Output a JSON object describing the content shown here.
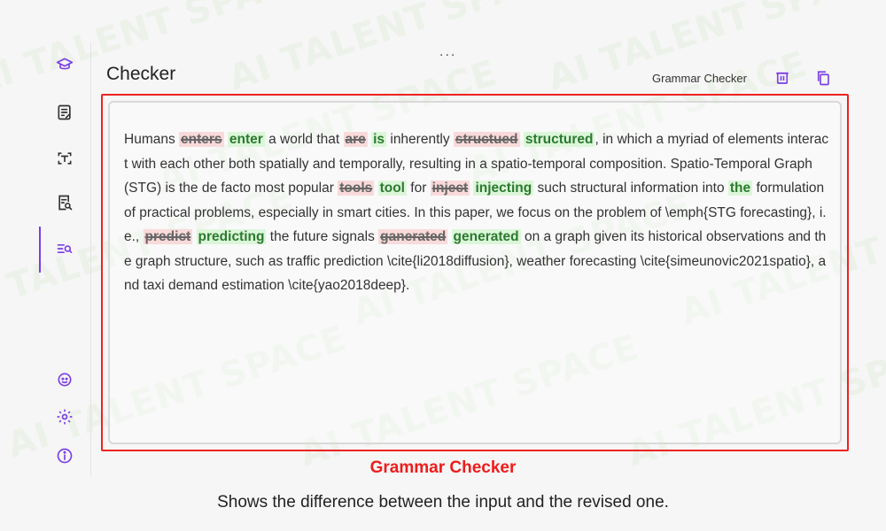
{
  "header": {
    "more_label": "...",
    "title": "Checker",
    "mode_label": "Grammar Checker"
  },
  "sidebar": {
    "items": [
      {
        "icon": "graduation-cap-icon"
      },
      {
        "icon": "edit-note-icon"
      },
      {
        "icon": "text-scan-icon"
      },
      {
        "icon": "document-search-icon"
      },
      {
        "icon": "list-search-icon",
        "active": true
      }
    ],
    "bottom": [
      {
        "icon": "assistant-face-icon"
      },
      {
        "icon": "settings-gear-icon"
      },
      {
        "icon": "info-icon"
      }
    ]
  },
  "colors": {
    "accent": "#7b3fe4",
    "highlight_frame": "#ee2222",
    "deleted_bg": "#f9dada",
    "inserted_bg": "#dcf6d9",
    "inserted_text": "#2b7a2f"
  },
  "document": {
    "segments": [
      {
        "type": "text",
        "text": "Humans "
      },
      {
        "type": "del",
        "text": "enters"
      },
      {
        "type": "text",
        "text": " "
      },
      {
        "type": "ins",
        "text": "enter"
      },
      {
        "type": "text",
        "text": " a world that "
      },
      {
        "type": "del",
        "text": "are"
      },
      {
        "type": "text",
        "text": " "
      },
      {
        "type": "ins",
        "text": "is"
      },
      {
        "type": "text",
        "text": " inherently "
      },
      {
        "type": "del",
        "text": "structued"
      },
      {
        "type": "text",
        "text": " "
      },
      {
        "type": "ins",
        "text": "structured"
      },
      {
        "type": "text",
        "text": ", in which a myriad of elements interact with each other both spatially and temporally, resulting in a spatio-temporal composition. Spatio-Temporal Graph (STG) is the de facto most popular "
      },
      {
        "type": "del",
        "text": "tools"
      },
      {
        "type": "text",
        "text": " "
      },
      {
        "type": "ins",
        "text": "tool"
      },
      {
        "type": "text",
        "text": " for "
      },
      {
        "type": "del",
        "text": "inject"
      },
      {
        "type": "text",
        "text": " "
      },
      {
        "type": "ins",
        "text": "injecting"
      },
      {
        "type": "text",
        "text": " such structural information into "
      },
      {
        "type": "ins",
        "text": "the"
      },
      {
        "type": "text",
        "text": " formulation of practical problems, especially in smart cities. In this paper, we focus on the problem of \\emph{STG forecasting}, i.e., "
      },
      {
        "type": "del",
        "text": "predict"
      },
      {
        "type": "text",
        "text": " "
      },
      {
        "type": "ins",
        "text": "predicting"
      },
      {
        "type": "text",
        "text": " the future signals "
      },
      {
        "type": "del",
        "text": "ganerated"
      },
      {
        "type": "text",
        "text": " "
      },
      {
        "type": "ins",
        "text": "generated"
      },
      {
        "type": "text",
        "text": " on a graph given its historical observations and the graph structure, such as traffic prediction \\cite{li2018diffusion}, weather forecasting \\cite{simeunovic2021spatio}, and taxi demand estimation \\cite{yao2018deep}."
      }
    ]
  },
  "caption": {
    "title": "Grammar Checker",
    "subtitle": "Shows the difference between the input and the revised one."
  },
  "watermark": {
    "text": "AI TALENT SPACE"
  }
}
